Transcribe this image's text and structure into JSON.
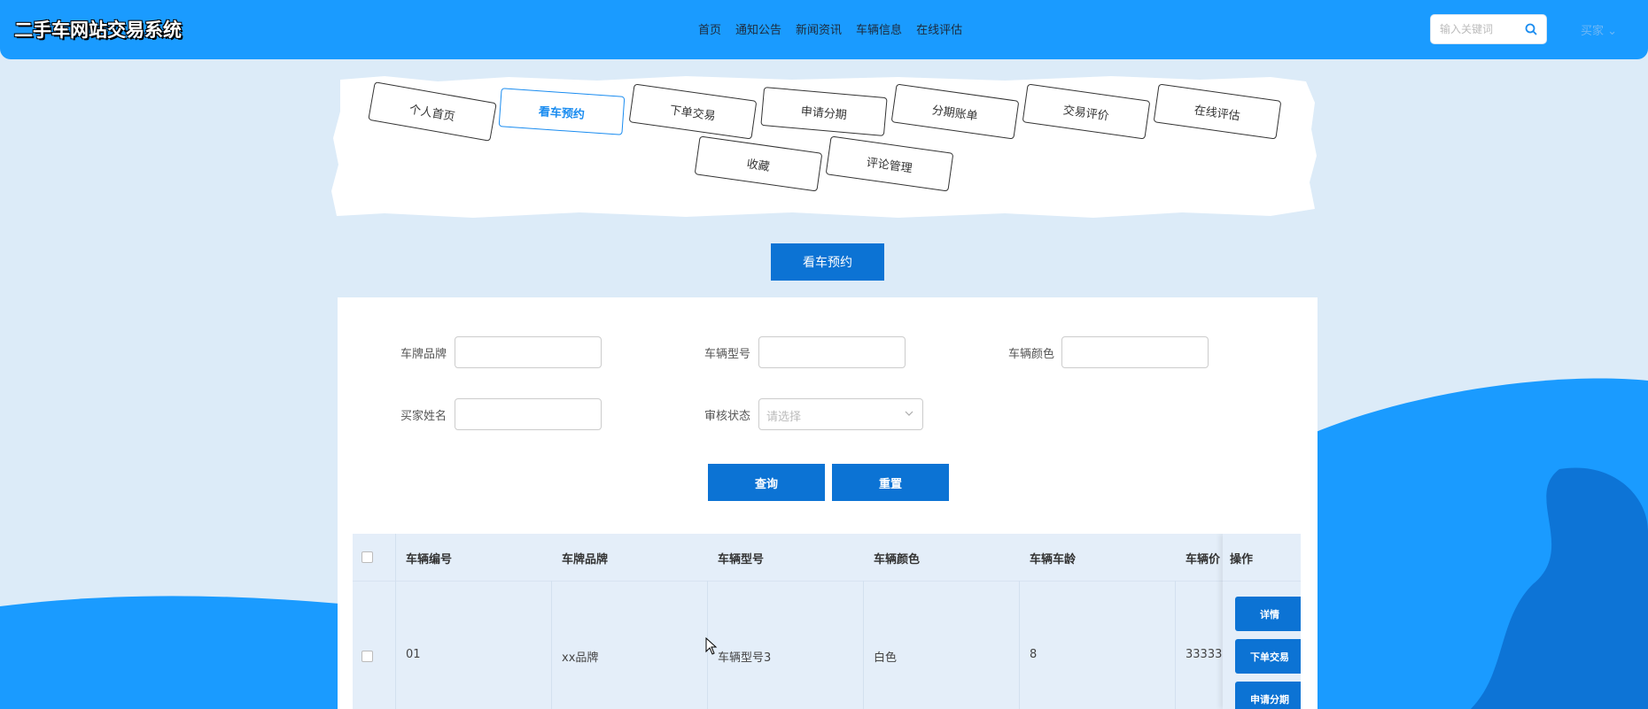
{
  "header": {
    "logo": "二手车网站交易系统",
    "nav": [
      "首页",
      "通知公告",
      "新闻资讯",
      "车辆信息",
      "在线评估"
    ],
    "search_placeholder": "输入关键词",
    "user": "买家 ⌄"
  },
  "tabs": [
    "个人首页",
    "看车预约",
    "下单交易",
    "申请分期",
    "分期账单",
    "交易评价",
    "在线评估",
    "收藏",
    "评论管理"
  ],
  "active_tab": "看车预约",
  "page_title": "看车预约",
  "filters": {
    "brand_label": "车牌品牌",
    "model_label": "车辆型号",
    "color_label": "车辆颜色",
    "buyer_label": "买家姓名",
    "status_label": "审核状态",
    "status_placeholder": "请选择"
  },
  "buttons": {
    "query": "查询",
    "reset": "重置"
  },
  "table": {
    "headers": [
      "车辆编号",
      "车牌品牌",
      "车辆型号",
      "车辆颜色",
      "车辆车龄",
      "车辆价"
    ],
    "ops_header": "操作",
    "row": [
      "01",
      "xx品牌",
      "车辆型号3",
      "白色",
      "8",
      "33333"
    ],
    "row_actions": [
      "详情",
      "下单交易",
      "申请分期"
    ]
  },
  "colors": {
    "primary": "#1a9bff",
    "button": "#0c73d4",
    "background": "#dcebf8"
  }
}
